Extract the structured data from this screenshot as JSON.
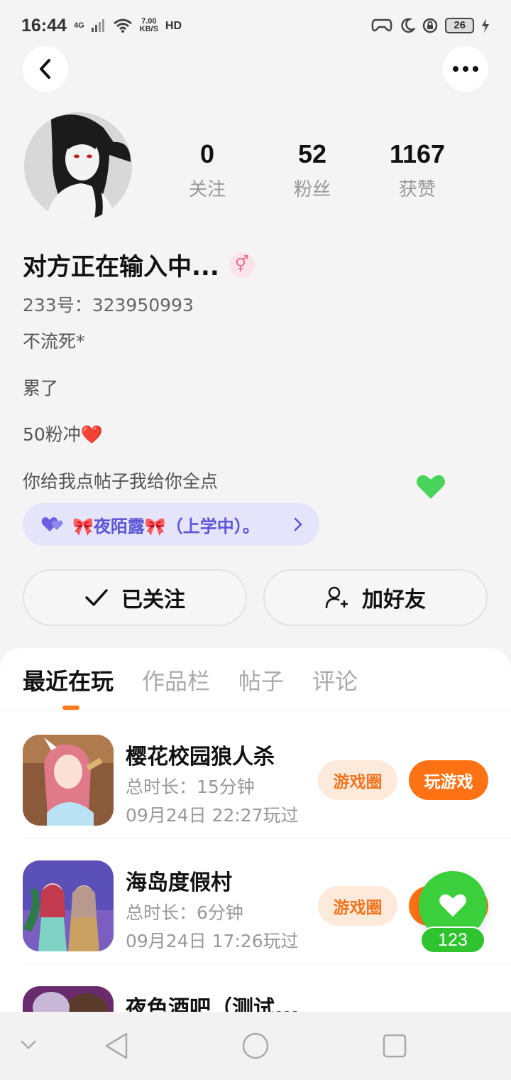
{
  "status_bar": {
    "time": "16:44",
    "network": "4G",
    "speed_value": "7.00",
    "speed_unit": "KB/S",
    "hd": "HD",
    "battery": "26"
  },
  "profile": {
    "stats": [
      {
        "value": "0",
        "label": "关注"
      },
      {
        "value": "52",
        "label": "粉丝"
      },
      {
        "value": "1167",
        "label": "获赞"
      }
    ],
    "username": "对方正在输入中...",
    "gender_symbol": "⚥",
    "id_line": "233号：323950993",
    "bio_lines": [
      "不流死*",
      "累了",
      "50粉冲❤️",
      "你给我点帖子我给你全点"
    ],
    "club_label": "🎀夜陌露🎀（上学中）。",
    "colors": {
      "accent": "#ff7214",
      "club_text": "#5b55d6",
      "like_green": "#3ccf3c"
    }
  },
  "actions": {
    "follow_label": "已关注",
    "add_friend_label": "加好友"
  },
  "tabs": [
    "最近在玩",
    "作品栏",
    "帖子",
    "评论"
  ],
  "games": [
    {
      "title": "樱花校园狼人杀",
      "duration": "总时长：15分钟",
      "last_played": "09月24日 22:27玩过",
      "circle_label": "游戏圈",
      "play_label": "玩游戏"
    },
    {
      "title": "海岛度假村",
      "duration": "总时长：6分钟",
      "last_played": "09月24日 17:26玩过",
      "circle_label": "游戏圈",
      "play_label": "玩游戏"
    },
    {
      "title": "夜色酒吧（测试..."
    }
  ],
  "like_widget": {
    "count": "123"
  }
}
